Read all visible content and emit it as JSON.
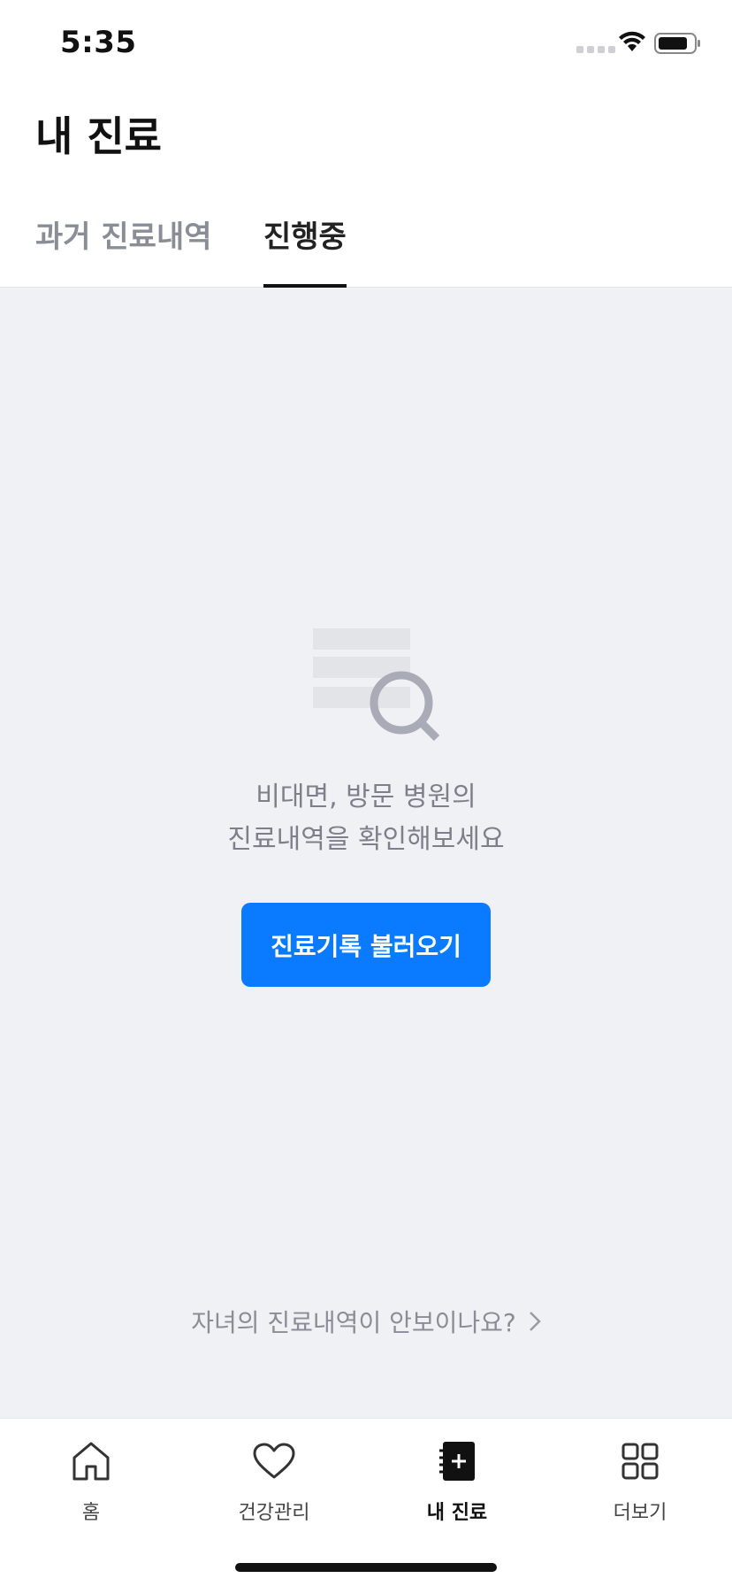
{
  "status_bar": {
    "time": "5:35"
  },
  "header": {
    "title": "내 진료"
  },
  "tabs": [
    {
      "label": "과거 진료내역",
      "active": false
    },
    {
      "label": "진행중",
      "active": true
    }
  ],
  "empty_state": {
    "icon": "document-search-icon",
    "message_line1": "비대면, 방문 병원의",
    "message_line2": "진료내역을 확인해보세요",
    "button_label": "진료기록 불러오기"
  },
  "child_link": {
    "label": "자녀의 진료내역이 안보이나요?"
  },
  "bottom_nav": {
    "items": [
      {
        "label": "홈",
        "icon": "home-icon",
        "active": false
      },
      {
        "label": "건강관리",
        "icon": "heart-icon",
        "active": false
      },
      {
        "label": "내 진료",
        "icon": "notebook-plus-icon",
        "active": true
      },
      {
        "label": "더보기",
        "icon": "grid-icon",
        "active": false
      }
    ]
  },
  "colors": {
    "accent": "#0a7aff",
    "background": "#f0f1f5",
    "muted_text": "#7d808a"
  }
}
